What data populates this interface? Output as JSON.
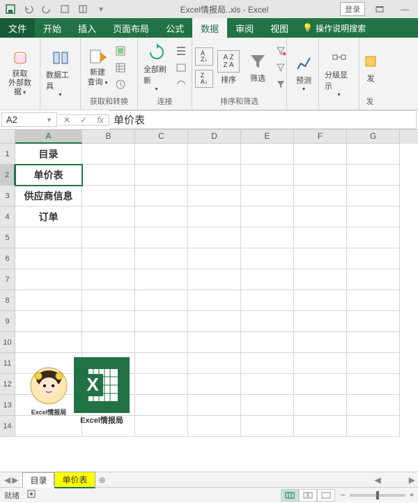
{
  "titlebar": {
    "filename": "Excel情报局..xls - Excel",
    "login": "登录"
  },
  "menu": {
    "file": "文件",
    "tabs": [
      "开始",
      "插入",
      "页面布局",
      "公式",
      "数据",
      "审阅",
      "视图"
    ],
    "active": "数据",
    "help": "操作说明搜索"
  },
  "ribbon": {
    "groups": {
      "external": {
        "btn": "获取\n外部数据",
        "label": ""
      },
      "tools": {
        "btn": "数据工具",
        "label": ""
      },
      "get": {
        "btn": "新建\n查询",
        "label": "获取和转换"
      },
      "conn": {
        "btn": "全部刷新",
        "label": "连接"
      },
      "sort": {
        "az": "排序",
        "filter": "筛选",
        "label": "排序和筛选"
      },
      "forecast": {
        "btn": "预测",
        "label": ""
      },
      "outline": {
        "btn": "分级显示",
        "label": ""
      },
      "dev": {
        "label": "发"
      }
    }
  },
  "formula": {
    "namebox": "A2",
    "value": "单价表"
  },
  "grid": {
    "cols": [
      "A",
      "B",
      "C",
      "D",
      "E",
      "F",
      "G"
    ],
    "rows": [
      1,
      2,
      3,
      4,
      5,
      6,
      7,
      8,
      9,
      10,
      11,
      12,
      13,
      14
    ],
    "cells": {
      "A1": "目录",
      "A2": "单价表",
      "A3": "供应商信息",
      "A4": "订单"
    },
    "watermark_caption_small": "Excel情报局",
    "watermark_caption": "Excel情报局"
  },
  "sheets": {
    "tabs": [
      "目录",
      "单价表"
    ],
    "active": "单价表",
    "add": "+"
  },
  "status": {
    "ready": "就绪",
    "zoom_minus": "−",
    "zoom_plus": "+"
  }
}
